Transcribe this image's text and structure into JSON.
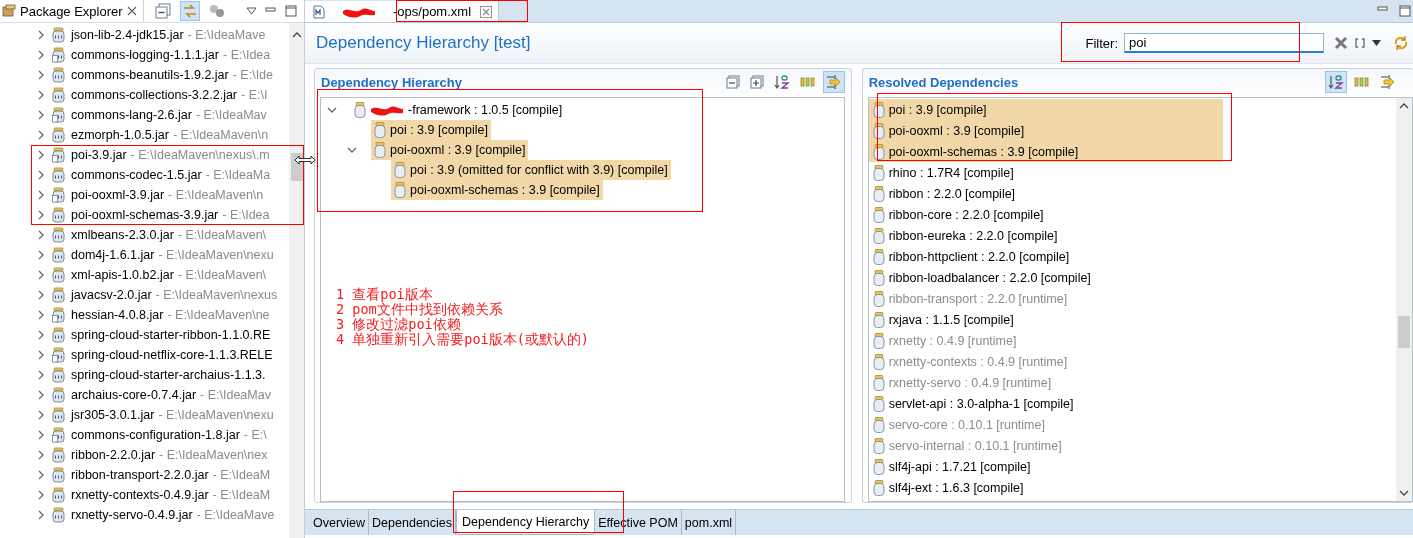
{
  "package_explorer": {
    "title": "Package Explorer",
    "items": [
      {
        "name": "json-lib-2.4-jdk15.jar",
        "path": "- E:\\IdeaMave",
        "kind": "jar"
      },
      {
        "name": "commons-logging-1.1.1.jar",
        "path": "- E:\\Idea",
        "kind": "jar-src"
      },
      {
        "name": "commons-beanutils-1.9.2.jar",
        "path": "- E:\\Ide",
        "kind": "jar"
      },
      {
        "name": "commons-collections-3.2.2.jar",
        "path": "- E:\\I",
        "kind": "jar"
      },
      {
        "name": "commons-lang-2.6.jar",
        "path": "- E:\\IdeaMav",
        "kind": "jar-src"
      },
      {
        "name": "ezmorph-1.0.5.jar",
        "path": "- E:\\IdeaMaven\\n",
        "kind": "jar"
      },
      {
        "name": "poi-3.9.jar",
        "path": "- E:\\IdeaMaven\\nexus\\.m",
        "kind": "jar-src"
      },
      {
        "name": "commons-codec-1.5.jar",
        "path": "- E:\\IdeaMa",
        "kind": "jar"
      },
      {
        "name": "poi-ooxml-3.9.jar",
        "path": "- E:\\IdeaMaven\\n",
        "kind": "jar-src"
      },
      {
        "name": "poi-ooxml-schemas-3.9.jar",
        "path": "- E:\\Idea",
        "kind": "jar"
      },
      {
        "name": "xmlbeans-2.3.0.jar",
        "path": "- E:\\IdeaMaven\\",
        "kind": "jar"
      },
      {
        "name": "dom4j-1.6.1.jar",
        "path": "- E:\\IdeaMaven\\nexu",
        "kind": "jar"
      },
      {
        "name": "xml-apis-1.0.b2.jar",
        "path": "- E:\\IdeaMaven\\",
        "kind": "jar"
      },
      {
        "name": "javacsv-2.0.jar",
        "path": "- E:\\IdeaMaven\\nexus",
        "kind": "jar"
      },
      {
        "name": "hessian-4.0.8.jar",
        "path": "- E:\\IdeaMaven\\ne",
        "kind": "jar-src"
      },
      {
        "name": "spring-cloud-starter-ribbon-1.1.0.RE",
        "kind": "jar"
      },
      {
        "name": "spring-cloud-netflix-core-1.1.3.RELE",
        "kind": "jar-src"
      },
      {
        "name": "spring-cloud-starter-archaius-1.1.3.",
        "kind": "jar"
      },
      {
        "name": "archaius-core-0.7.4.jar",
        "path": "- E:\\IdeaMav",
        "kind": "jar"
      },
      {
        "name": "jsr305-3.0.1.jar",
        "path": "- E:\\IdeaMaven\\nexu",
        "kind": "jar"
      },
      {
        "name": "commons-configuration-1.8.jar",
        "path": "- E:\\",
        "kind": "jar-src"
      },
      {
        "name": "ribbon-2.2.0.jar",
        "path": "- E:\\IdeaMaven\\nex",
        "kind": "jar"
      },
      {
        "name": "ribbon-transport-2.2.0.jar",
        "path": "- E:\\IdeaM",
        "kind": "jar"
      },
      {
        "name": "rxnetty-contexts-0.4.9.jar",
        "path": "- E:\\IdeaM",
        "kind": "jar"
      },
      {
        "name": "rxnetty-servo-0.4.9.jar",
        "path": "- E:\\IdeaMave",
        "kind": "jar"
      }
    ]
  },
  "editor": {
    "tab": {
      "title": "-ops/pom.xml",
      "redacted": true
    },
    "page_title": "Dependency Hierarchy [test]",
    "filter": {
      "label": "Filter:",
      "value": "poi"
    },
    "hierarchy": {
      "title": "Dependency Hierarchy",
      "toolbar": [
        {
          "kind": "collapse",
          "selected": false
        },
        {
          "kind": "expand",
          "selected": false
        },
        {
          "kind": "sort",
          "selected": false
        },
        {
          "kind": "columns",
          "selected": false
        },
        {
          "kind": "link",
          "selected": true
        }
      ],
      "tree": [
        {
          "text": "-framework : 1.0.5 [compile]",
          "redacted": true,
          "matched": false,
          "expanded": true,
          "children": [
            {
              "text": "poi : 3.9 [compile]",
              "redacted": false,
              "matched": true
            },
            {
              "text": "poi-ooxml : 3.9 [compile]",
              "redacted": false,
              "matched": true,
              "expanded": true,
              "children": [
                {
                  "text": "poi : 3.9 (omitted for conflict with 3.9) [compile]",
                  "redacted": false,
                  "matched": true
                },
                {
                  "text": "poi-ooxml-schemas : 3.9 [compile]",
                  "redacted": false,
                  "matched": true
                }
              ]
            }
          ]
        }
      ]
    },
    "resolved": {
      "title": "Resolved Dependencies",
      "toolbar": [
        {
          "kind": "sort",
          "selected": true
        },
        {
          "kind": "columns",
          "selected": false
        },
        {
          "kind": "link",
          "selected": false
        }
      ],
      "items": [
        {
          "text": "poi : 3.9 [compile]",
          "matched": true,
          "greyed": false
        },
        {
          "text": "poi-ooxml : 3.9 [compile]",
          "matched": true,
          "greyed": false
        },
        {
          "text": "poi-ooxml-schemas : 3.9 [compile]",
          "matched": true,
          "greyed": false
        },
        {
          "text": "rhino : 1.7R4 [compile]",
          "matched": false,
          "greyed": false
        },
        {
          "text": "ribbon : 2.2.0 [compile]",
          "matched": false,
          "greyed": false
        },
        {
          "text": "ribbon-core : 2.2.0 [compile]",
          "matched": false,
          "greyed": false
        },
        {
          "text": "ribbon-eureka : 2.2.0 [compile]",
          "matched": false,
          "greyed": false
        },
        {
          "text": "ribbon-httpclient : 2.2.0 [compile]",
          "matched": false,
          "greyed": false
        },
        {
          "text": "ribbon-loadbalancer : 2.2.0 [compile]",
          "matched": false,
          "greyed": false
        },
        {
          "text": "ribbon-transport : 2.2.0 [runtime]",
          "matched": false,
          "greyed": true
        },
        {
          "text": "rxjava : 1.1.5 [compile]",
          "matched": false,
          "greyed": false
        },
        {
          "text": "rxnetty : 0.4.9 [runtime]",
          "matched": false,
          "greyed": true
        },
        {
          "text": "rxnetty-contexts : 0.4.9 [runtime]",
          "matched": false,
          "greyed": true
        },
        {
          "text": "rxnetty-servo : 0.4.9 [runtime]",
          "matched": false,
          "greyed": true
        },
        {
          "text": "servlet-api : 3.0-alpha-1 [compile]",
          "matched": false,
          "greyed": false
        },
        {
          "text": "servo-core : 0.10.1 [runtime]",
          "matched": false,
          "greyed": true
        },
        {
          "text": "servo-internal : 0.10.1 [runtime]",
          "matched": false,
          "greyed": true
        },
        {
          "text": "slf4j-api : 1.7.21 [compile]",
          "matched": false,
          "greyed": false
        },
        {
          "text": "slf4j-ext : 1.6.3 [compile]",
          "matched": false,
          "greyed": false
        }
      ]
    },
    "notes": [
      "1 查看poi版本",
      "2 pom文件中找到依赖关系",
      "3 修改过滤poi依赖",
      "4 单独重新引入需要poi版本(或默认的)"
    ],
    "bottom_tabs": [
      {
        "label": "Overview",
        "selected": false
      },
      {
        "label": "Dependencies",
        "selected": false
      },
      {
        "label": "Dependency Hierarchy",
        "selected": true
      },
      {
        "label": "Effective POM",
        "selected": false
      },
      {
        "label": "pom.xml",
        "selected": false
      }
    ]
  }
}
